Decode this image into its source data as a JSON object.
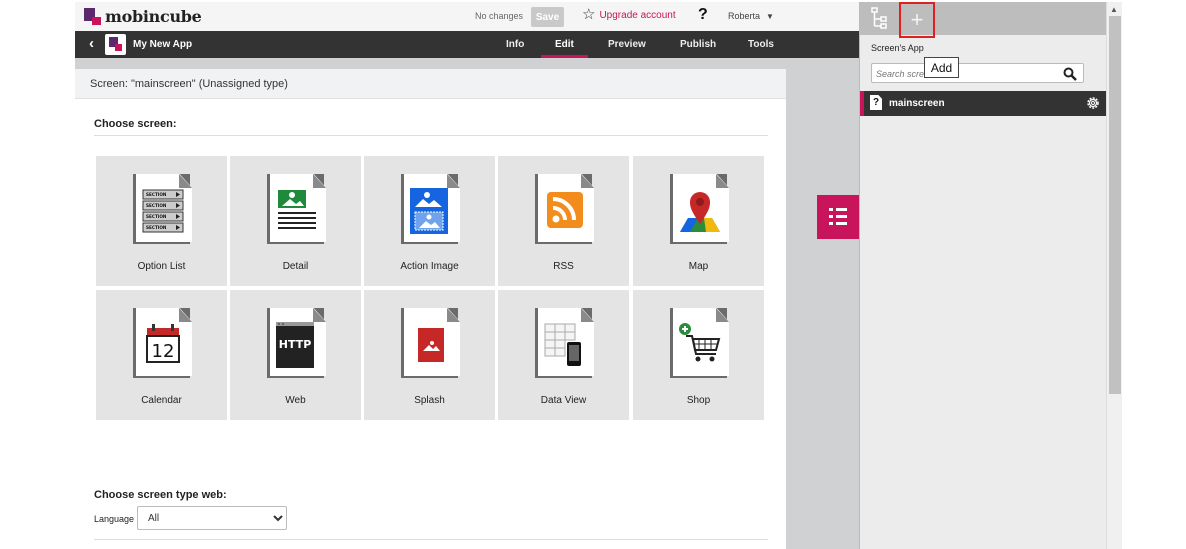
{
  "topbar": {
    "logo_text": "mobincube",
    "status": "No changes",
    "save_label": "Save",
    "upgrade_label": "Upgrade account",
    "help_label": "?",
    "user_name": "Roberta"
  },
  "navbar": {
    "back_icon": "chevron-left",
    "app_name": "My New App",
    "tabs": [
      "Info",
      "Edit",
      "Preview",
      "Publish",
      "Tools"
    ],
    "active_tab": "Edit"
  },
  "content": {
    "screen_header": "Screen: \"mainscreen\" (Unassigned type)",
    "choose_screen": "Choose screen:",
    "tiles": [
      {
        "label": "Option List",
        "icon": "option-list-icon"
      },
      {
        "label": "Detail",
        "icon": "detail-icon"
      },
      {
        "label": "Action Image",
        "icon": "action-image-icon"
      },
      {
        "label": "RSS",
        "icon": "rss-icon"
      },
      {
        "label": "Map",
        "icon": "map-icon"
      },
      {
        "label": "Calendar",
        "icon": "calendar-icon"
      },
      {
        "label": "Web",
        "icon": "web-icon"
      },
      {
        "label": "Splash",
        "icon": "splash-icon"
      },
      {
        "label": "Data View",
        "icon": "data-view-icon"
      },
      {
        "label": "Shop",
        "icon": "shop-icon"
      }
    ],
    "option_list_sections": [
      "SECTION",
      "SECTION",
      "SECTION",
      "SECTION"
    ],
    "calendar_day": "12",
    "web_text": "HTTP",
    "choose_screen_type_web": "Choose screen type web:",
    "language_label": "Language",
    "language_value": "All"
  },
  "panel": {
    "title": "Screen's App",
    "search_placeholder": "Search screen",
    "tooltip": "Add",
    "add_symbol": "+",
    "screens": [
      {
        "name": "mainscreen",
        "icon_char": "?"
      }
    ]
  },
  "colors": {
    "accent": "#c8145a",
    "brand_purple": "#5b2a6e",
    "nav_bg": "#333333",
    "tile_bg": "#e4e4e4"
  }
}
